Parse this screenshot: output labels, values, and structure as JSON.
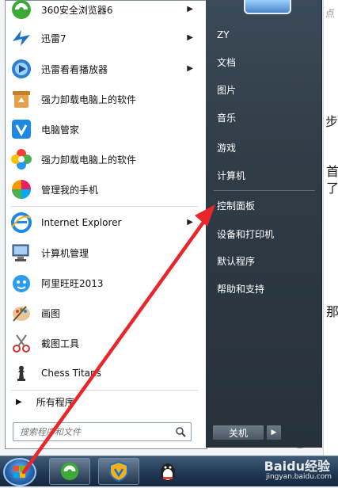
{
  "background": {
    "right_snippets": [
      "点",
      "步",
      "首",
      "了",
      "那"
    ]
  },
  "left_menu": {
    "items": [
      {
        "label": "360安全浏览器6",
        "icon": "browser-360-icon",
        "has_arrow": true
      },
      {
        "label": "迅雷7",
        "icon": "thunder-bird-icon",
        "has_arrow": true
      },
      {
        "label": "迅雷看看播放器",
        "icon": "player-icon",
        "has_arrow": true
      },
      {
        "label": "强力卸载电脑上的软件",
        "icon": "recycle-box-icon",
        "has_arrow": false
      },
      {
        "label": "电脑管家",
        "icon": "shield-v-icon",
        "has_arrow": false
      },
      {
        "label": "强力卸载电脑上的软件",
        "icon": "flower-icon",
        "has_arrow": false
      },
      {
        "label": "管理我的手机",
        "icon": "colorful-ball-icon",
        "has_arrow": false
      },
      {
        "label": "Internet Explorer",
        "icon": "ie-icon",
        "has_arrow": true
      },
      {
        "label": "计算机管理",
        "icon": "computer-management-icon",
        "has_arrow": false
      },
      {
        "label": "阿里旺旺2013",
        "icon": "wangwang-icon",
        "has_arrow": false
      },
      {
        "label": "画图",
        "icon": "paint-palette-icon",
        "has_arrow": false
      },
      {
        "label": "截图工具",
        "icon": "scissors-icon",
        "has_arrow": false
      },
      {
        "label": "Chess Titans",
        "icon": "chess-icon",
        "has_arrow": false
      }
    ],
    "all_programs_label": "所有程序",
    "search_placeholder": "搜索程序和文件"
  },
  "right_menu": {
    "items": [
      "ZY",
      "文档",
      "图片",
      "音乐",
      "游戏",
      "计算机",
      "控制面板",
      "设备和打印机",
      "默认程序",
      "帮助和支持"
    ],
    "shutdown_label": "关机"
  },
  "taskbar": {
    "watermark": "Baidu经验",
    "watermark_sub": "jingyan.baidu.com"
  },
  "colors": {
    "annotation_red": "#e8262b",
    "right_panel": "#2f3b45",
    "taskbar": "#1f3651"
  }
}
